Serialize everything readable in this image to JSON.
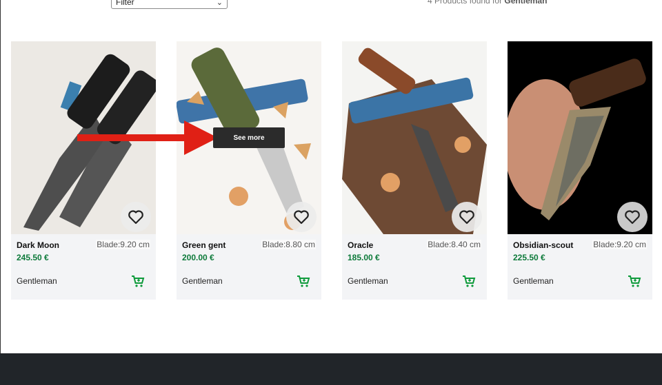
{
  "filter": {
    "label": "Filter"
  },
  "results": {
    "prefix": "4 Products found for",
    "query": "Gentleman"
  },
  "overlay": {
    "see_more": "See more"
  },
  "products": [
    {
      "name": "Dark Moon",
      "blade": "Blade:9.20 cm",
      "price": "245.50 €",
      "brand": "Gentleman"
    },
    {
      "name": "Green gent",
      "blade": "Blade:8.80 cm",
      "price": "200.00 €",
      "brand": "Gentleman"
    },
    {
      "name": "Oracle",
      "blade": "Blade:8.40 cm",
      "price": "185.00 €",
      "brand": "Gentleman"
    },
    {
      "name": "Obsidian-scout",
      "blade": "Blade:9.20 cm",
      "price": "225.50 €",
      "brand": "Gentleman"
    }
  ],
  "icons": {
    "favorite": "heart-icon",
    "cart": "cart-icon",
    "dropdown": "chevron-down-icon"
  },
  "colors": {
    "price": "#0d7a3a",
    "cart": "#0d9a3a",
    "footer": "#212529",
    "arrow": "#e02015"
  }
}
